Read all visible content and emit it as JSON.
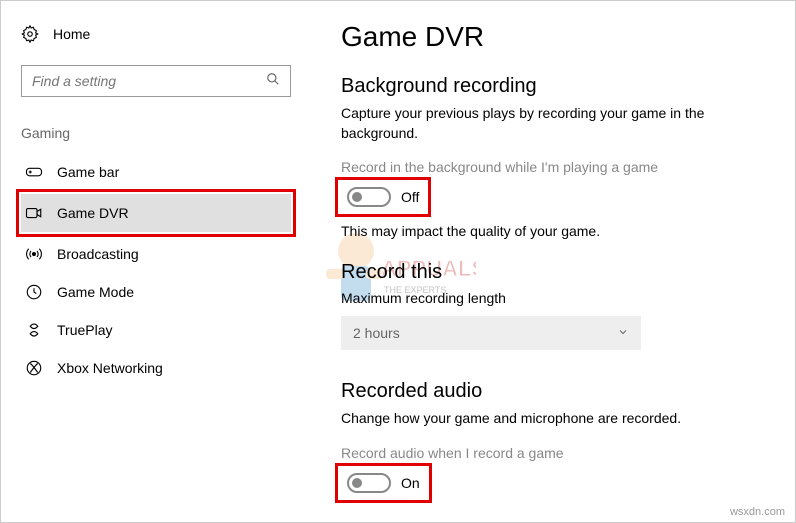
{
  "sidebar": {
    "home": "Home",
    "search_placeholder": "Find a setting",
    "category": "Gaming",
    "items": [
      {
        "label": "Game bar"
      },
      {
        "label": "Game DVR"
      },
      {
        "label": "Broadcasting"
      },
      {
        "label": "Game Mode"
      },
      {
        "label": "TruePlay"
      },
      {
        "label": "Xbox Networking"
      }
    ]
  },
  "main": {
    "title": "Game DVR",
    "bg_recording": {
      "heading": "Background recording",
      "desc": "Capture your previous plays by recording your game in the background.",
      "toggle_label": "Record in the background while I'm playing a game",
      "toggle_value": "Off",
      "note": "This may impact the quality of your game."
    },
    "record_this": {
      "heading": "Record this",
      "label": "Maximum recording length",
      "value": "2 hours"
    },
    "recorded_audio": {
      "heading": "Recorded audio",
      "desc": "Change how your game and microphone are recorded.",
      "toggle_label": "Record audio when I record a game",
      "toggle_value": "On"
    }
  },
  "watermark": "wsxdn.com"
}
